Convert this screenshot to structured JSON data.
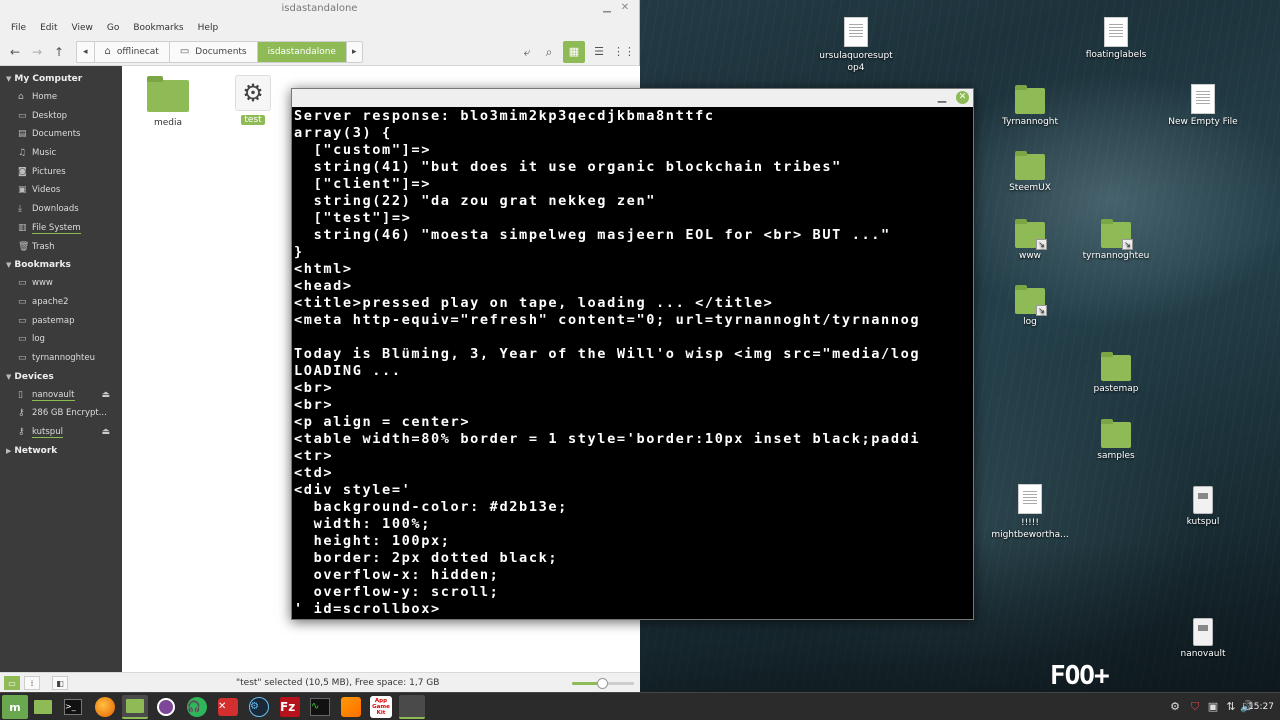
{
  "file_manager": {
    "title": "isdastandalone",
    "menu": [
      "File",
      "Edit",
      "View",
      "Go",
      "Bookmarks",
      "Help"
    ],
    "breadcrumbs": [
      "offlinecat",
      "Documents",
      "isdastandalone"
    ],
    "sidebar": {
      "my_computer": "My Computer",
      "my_computer_items": [
        "Home",
        "Desktop",
        "Documents",
        "Music",
        "Pictures",
        "Videos",
        "Downloads",
        "File System",
        "Trash"
      ],
      "bookmarks": "Bookmarks",
      "bookmark_items": [
        "www",
        "apache2",
        "pastemap",
        "log",
        "tyrnannoghteu"
      ],
      "devices": "Devices",
      "device_items": [
        "nanovault",
        "286 GB Encrypt...",
        "kutspul"
      ],
      "network": "Network"
    },
    "files": [
      {
        "name": "media",
        "type": "folder"
      },
      {
        "name": "test",
        "type": "executable"
      }
    ],
    "status_text": "\"test\" selected (10,5 MB), Free space: 1,7 GB",
    "zoom_level": 0.48
  },
  "terminal": {
    "lines": [
      "Server response: blo3mim2kp3qecdjkbma8nttfc",
      "array(3) {",
      "  [\"custom\"]=>",
      "  string(41) \"but does it use organic blockchain tribes\"",
      "  [\"client\"]=>",
      "  string(22) \"da zou grat nekkeg zen\"",
      "  [\"test\"]=>",
      "  string(46) \"moesta simpelweg masjeern EOL for <br> BUT ...\"",
      "}",
      "<html>",
      "<head>",
      "<title>pressed play on tape, loading ... </title>",
      "<meta http-equiv=\"refresh\" content=\"0; url=tyrnannoght/tyrnannog",
      "",
      "Today is Blüming, 3, Year of the Will'o wisp <img src=\"media/log",
      "LOADING ...",
      "<br>",
      "<br>",
      "<p align = center>",
      "<table width=80% border = 1 style='border:10px inset black;paddi",
      "<tr>",
      "<td>",
      "<div style='",
      "  background-color: #d2b13e;",
      "  width: 100%;",
      "  height: 100px;",
      "  border: 2px dotted black;",
      "  overflow-x: hidden;",
      "  overflow-y: scroll;",
      "' id=scrollbox>"
    ]
  },
  "desktop_icons": [
    {
      "label": "ursulaquoresupt op4",
      "kind": "doc"
    },
    {
      "label": "floatinglabels",
      "kind": "doc"
    },
    {
      "label": "Tyrnannoght",
      "kind": "folder"
    },
    {
      "label": "New Empty File",
      "kind": "doc"
    },
    {
      "label": "SteemUX",
      "kind": "folder"
    },
    {
      "label": "www",
      "kind": "folder-link"
    },
    {
      "label": "tyrnannoghteu",
      "kind": "folder-link"
    },
    {
      "label": "log",
      "kind": "folder-link"
    },
    {
      "label": "pastemap",
      "kind": "folder"
    },
    {
      "label": "samples",
      "kind": "folder"
    },
    {
      "label": "!!!!! mightbewortha...",
      "kind": "doc"
    },
    {
      "label": "kutspul",
      "kind": "drive"
    },
    {
      "label": "nanovault",
      "kind": "drive"
    }
  ],
  "taskbar": {
    "clock": "15:27",
    "apps": [
      "mint-menu-icon",
      "show-desktop-icon",
      "terminal-icon",
      "firefox-icon",
      "files-icon",
      "tor-icon",
      "headset-icon",
      "toolbox-icon",
      "steam-icon",
      "filezilla-icon",
      "system-monitor-icon",
      "sublime-icon",
      "app-game-kit-icon",
      "window-button"
    ],
    "appgamekit_label": "App Game Kit"
  },
  "colors": {
    "accent": "#8fbb57",
    "sidebar_bg": "#3b3b3b",
    "terminal_bg": "#000000",
    "terminal_fg": "#ffffff"
  }
}
